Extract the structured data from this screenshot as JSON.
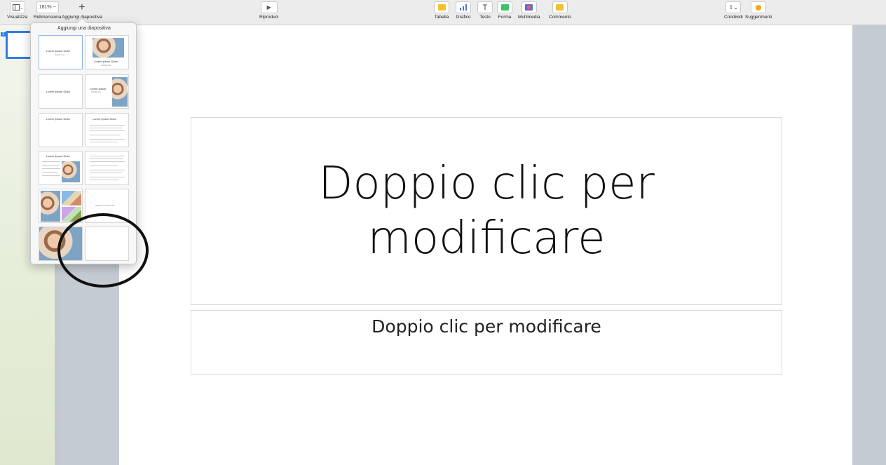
{
  "toolbar": {
    "view": {
      "label": "Visualizza",
      "icon": "sidebar-icon"
    },
    "zoom": {
      "label": "Ridimensiona",
      "value": "181% ~"
    },
    "add_slide": {
      "label": "Aggiungi diapositiva",
      "icon": "plus-icon"
    },
    "play": {
      "label": "Riproduci",
      "icon": "play-icon"
    },
    "inserts": [
      {
        "label": "Tabella",
        "icon": "table-icon",
        "color": "#f2c230"
      },
      {
        "label": "Grafico",
        "icon": "chart-icon",
        "color": "#3b7fd6"
      },
      {
        "label": "Testo",
        "icon": "text-icon",
        "color": "#666666"
      },
      {
        "label": "Forma",
        "icon": "shape-icon",
        "color": "#3cc46a"
      },
      {
        "label": "Multimedia",
        "icon": "media-icon",
        "color": "#e06a4a"
      },
      {
        "label": "Commento",
        "icon": "comment-icon",
        "color": "#f2c230"
      }
    ],
    "share": {
      "label": "Condividi",
      "icon": "share-icon"
    },
    "tips": {
      "label": "Suggerimenti",
      "icon": "lightbulb-icon",
      "color": "#f2a81a"
    }
  },
  "navigator": {
    "slide_number": "1"
  },
  "slide": {
    "title": "Doppio clic per modificare",
    "subtitle": "Doppio clic per modificare"
  },
  "popover": {
    "title": "Aggiungi una diapositiva",
    "layouts": [
      {
        "title": "Lorem Ipsum Dolor",
        "subtitle": "Subtitle here"
      },
      {
        "title": "Lorem Ipsum Dolor",
        "subtitle": "Subtitle here"
      },
      {
        "title": "Lorem Ipsum Dolor"
      },
      {
        "title": "Lorem Ipsum",
        "subtitle": "Subtitle here"
      },
      {
        "title": "Lorem Ipsum Dolor"
      },
      {
        "title": "Lorem Ipsum Dolor"
      },
      {
        "title": "Lorem Ipsum Dolor"
      },
      {
        "title": ""
      },
      {
        "title": ""
      },
      {
        "title": "Statement or introduction"
      },
      {
        "title": ""
      },
      {
        "title": ""
      }
    ]
  }
}
